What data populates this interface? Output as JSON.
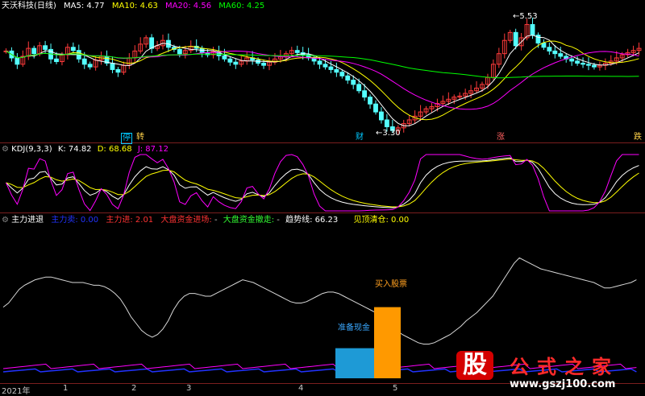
{
  "header": {
    "stock": "天沃科技(日线)",
    "ma5": "MA5: 4.77",
    "ma10": "MA10: 4.63",
    "ma20": "MA20: 4.56",
    "ma60": "MA60: 4.25",
    "colors": {
      "ma5": "#ffffff",
      "ma10": "#ffff00",
      "ma20": "#ff00ff",
      "ma60": "#00ff00"
    }
  },
  "kdj_header": {
    "title": "KDJ(9,3,3)",
    "k": "K: 74.82",
    "d": "D: 68.68",
    "j": "J: 87.12"
  },
  "indicator_header": {
    "title": "主力进退",
    "zhulimai": "主力卖: 0.00",
    "zhulijin": "主力进: 2.01",
    "dapan_in": "大盘资金进场:",
    "dapan_out": "大盘资金撤走:",
    "qushi": "趋势线: 66.23",
    "jianding": "见顶清仓: 0.00",
    "dash": "-"
  },
  "annotations": {
    "high": "5.53",
    "low": "3.30",
    "zhunbei": "准备现金",
    "mairu": "买入股票"
  },
  "badges": {
    "ting": "停",
    "zhuan": "转",
    "cai": "财",
    "zhang": "涨",
    "die": "跌"
  },
  "xaxis": {
    "year": "2021年",
    "m1": "1",
    "m2": "2",
    "m3": "3",
    "m4": "4",
    "m5": "5"
  },
  "logo": {
    "char": "股",
    "text": "公式之家",
    "url": "www.gszj100.com"
  },
  "chart_data": [
    {
      "type": "candlestick",
      "panel": "price",
      "title": "天沃科技(日线)",
      "ma_series": [
        {
          "name": "MA5",
          "value": 4.77
        },
        {
          "name": "MA10",
          "value": 4.63
        },
        {
          "name": "MA20",
          "value": 4.56
        },
        {
          "name": "MA60",
          "value": 4.25
        }
      ],
      "close": [
        4.85,
        4.72,
        4.6,
        4.75,
        4.9,
        4.8,
        4.95,
        4.88,
        4.7,
        4.65,
        4.78,
        4.92,
        4.86,
        4.7,
        4.6,
        4.55,
        4.68,
        4.75,
        4.62,
        4.5,
        4.45,
        4.58,
        4.72,
        4.85,
        4.98,
        5.1,
        4.9,
        4.95,
        5.05,
        4.92,
        4.88,
        4.8,
        4.86,
        4.94,
        4.9,
        4.82,
        4.78,
        4.84,
        4.76,
        4.7,
        4.64,
        4.6,
        4.66,
        4.72,
        4.68,
        4.62,
        4.58,
        4.64,
        4.7,
        4.74,
        4.8,
        4.86,
        4.82,
        4.78,
        4.72,
        4.66,
        4.6,
        4.55,
        4.5,
        4.45,
        4.38,
        4.3,
        4.22,
        4.1,
        3.98,
        3.85,
        3.7,
        3.55,
        3.42,
        3.35,
        3.4,
        3.48,
        3.55,
        3.62,
        3.7,
        3.76,
        3.8,
        3.86,
        3.9,
        3.94,
        3.98,
        4.0,
        4.05,
        4.1,
        4.15,
        4.22,
        4.35,
        4.6,
        4.8,
        5.05,
        5.2,
        4.95,
        5.1,
        5.35,
        5.15,
        5.0,
        4.92,
        4.85,
        4.8,
        4.75,
        4.7,
        4.66,
        4.62,
        4.6,
        4.58,
        4.55,
        4.58,
        4.62,
        4.66,
        4.72,
        4.78,
        4.82,
        4.86,
        4.9
      ],
      "high": 5.53,
      "low": 3.3
    },
    {
      "type": "line",
      "panel": "kdj",
      "title": "KDJ(9,3,3)",
      "series": [
        {
          "name": "K",
          "last": 74.82
        },
        {
          "name": "D",
          "last": 68.68
        },
        {
          "name": "J",
          "last": 87.12
        }
      ]
    },
    {
      "type": "line+bar",
      "panel": "indicator",
      "title": "主力进退",
      "series": [
        {
          "name": "主力卖",
          "last": 0.0
        },
        {
          "name": "主力进",
          "last": 2.01
        },
        {
          "name": "趋势线",
          "last": 66.23
        },
        {
          "name": "见顶清仓",
          "last": 0.0
        }
      ],
      "bars": [
        {
          "label": "准备现金",
          "value": 22
        },
        {
          "label": "买入股票",
          "value": 52
        }
      ],
      "ylim": [
        0,
        100
      ],
      "trend": [
        52,
        55,
        60,
        65,
        68,
        70,
        72,
        73,
        74,
        74,
        73,
        72,
        71,
        70,
        70,
        70,
        69,
        68,
        68,
        67,
        65,
        62,
        58,
        52,
        45,
        40,
        35,
        32,
        30,
        32,
        36,
        42,
        50,
        56,
        60,
        62,
        62,
        61,
        60,
        60,
        62,
        64,
        66,
        68,
        70,
        72,
        71,
        70,
        68,
        66,
        64,
        62,
        60,
        58,
        56,
        55,
        55,
        56,
        58,
        60,
        62,
        63,
        63,
        62,
        60,
        58,
        56,
        54,
        52,
        50,
        48,
        45,
        42,
        38,
        35,
        32,
        30,
        28,
        26,
        25,
        25,
        26,
        28,
        30,
        32,
        35,
        38,
        42,
        45,
        48,
        52,
        56,
        60,
        66,
        72,
        78,
        84,
        88,
        86,
        84,
        82,
        80,
        79,
        78,
        77,
        76,
        75,
        74,
        73,
        72,
        71,
        70,
        68,
        66,
        66,
        67,
        68,
        69,
        70,
        72
      ]
    }
  ]
}
